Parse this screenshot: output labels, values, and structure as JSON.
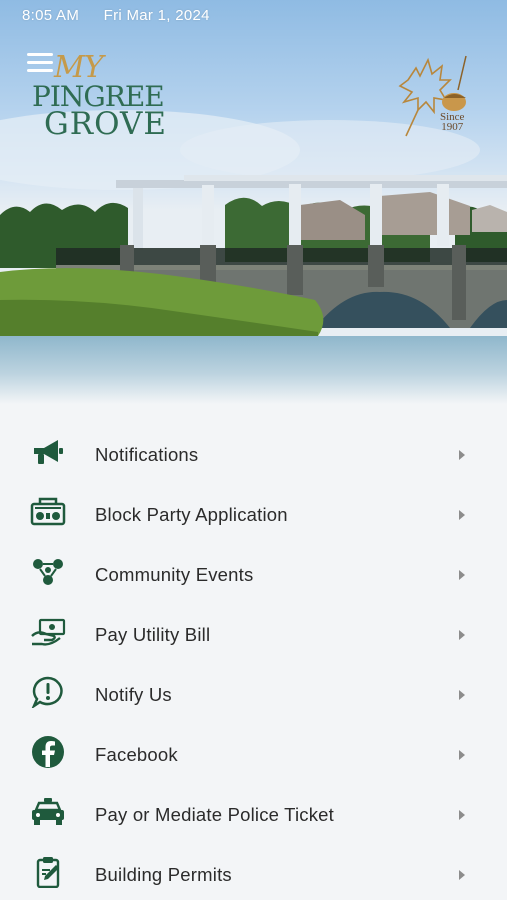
{
  "status_bar": {
    "time": "8:05 AM",
    "date": "Fri Mar 1, 2024"
  },
  "brand": {
    "logo_lines": [
      "MY",
      "PINGREE",
      "GROVE"
    ],
    "seal_text": [
      "Since",
      "1907"
    ],
    "colors": {
      "logo_green": "#2f6c53",
      "logo_gold": "#c59a4a",
      "icon_green": "#1f5a3d"
    }
  },
  "menu": {
    "items": [
      {
        "label": "Notifications",
        "icon": "megaphone-icon"
      },
      {
        "label": "Block Party Application",
        "icon": "boombox-icon"
      },
      {
        "label": "Community Events",
        "icon": "community-icon"
      },
      {
        "label": "Pay Utility Bill",
        "icon": "hand-money-icon"
      },
      {
        "label": "Notify Us",
        "icon": "alert-bubble-icon"
      },
      {
        "label": "Facebook",
        "icon": "facebook-icon"
      },
      {
        "label": "Pay or Mediate Police Ticket",
        "icon": "police-car-icon"
      },
      {
        "label": "Building Permits",
        "icon": "clipboard-edit-icon"
      }
    ]
  }
}
